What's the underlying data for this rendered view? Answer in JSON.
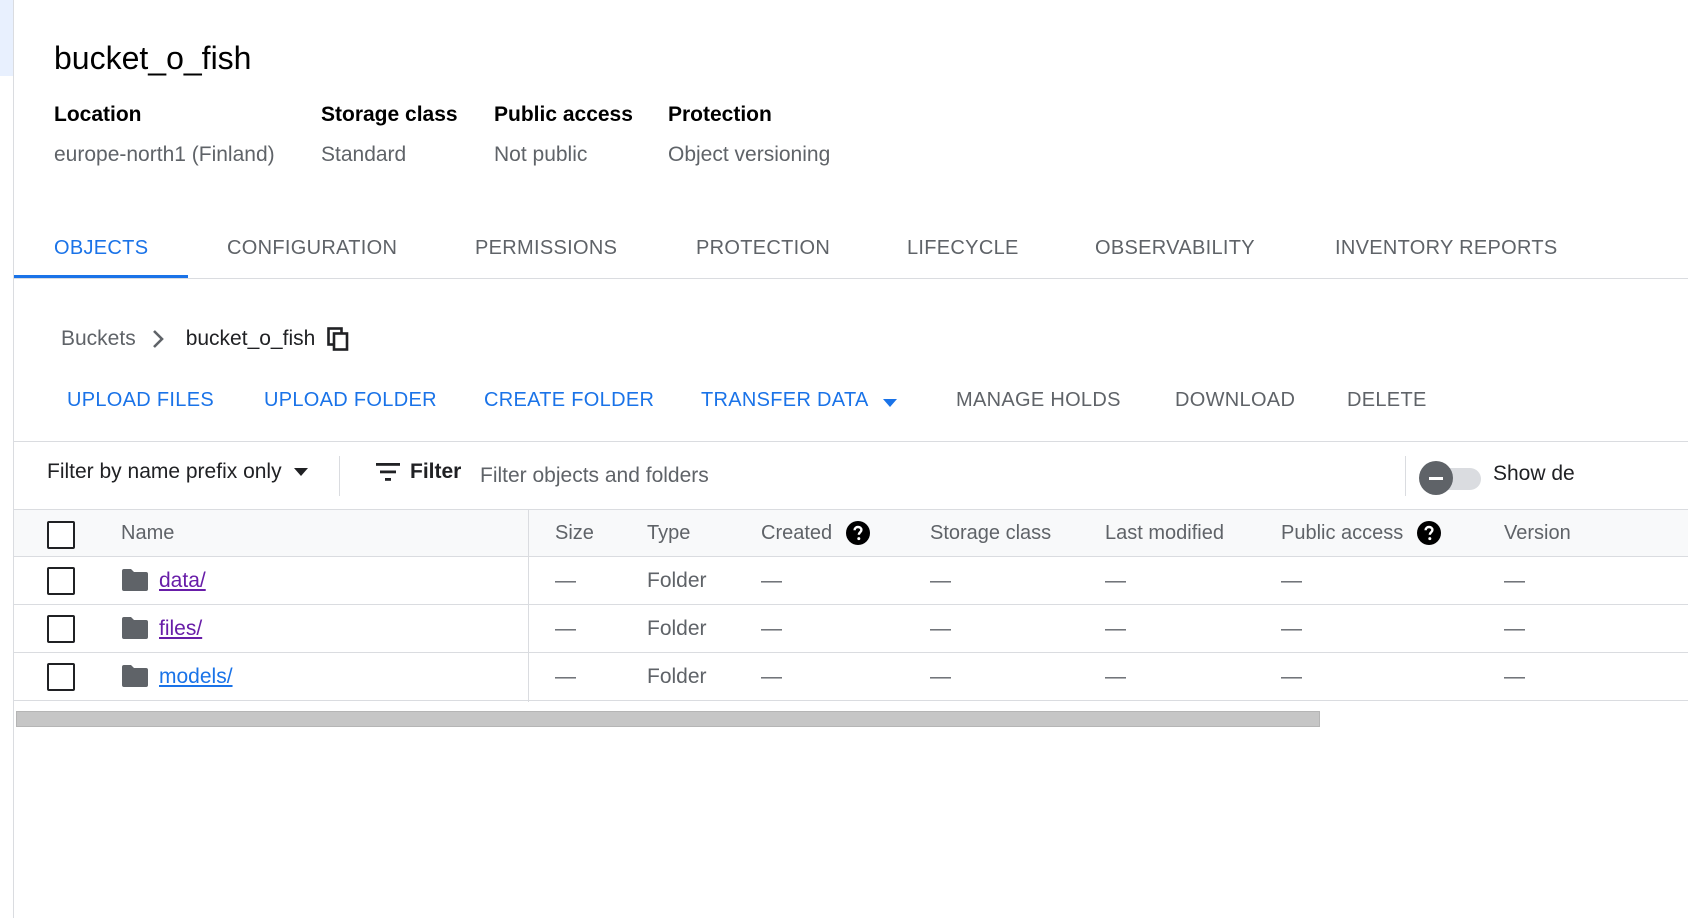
{
  "bucket": {
    "name": "bucket_o_fish",
    "details": [
      {
        "label": "Location",
        "value": "europe-north1 (Finland)"
      },
      {
        "label": "Storage class",
        "value": "Standard"
      },
      {
        "label": "Public access",
        "value": "Not public"
      },
      {
        "label": "Protection",
        "value": "Object versioning"
      }
    ]
  },
  "tabs": [
    {
      "label": "OBJECTS",
      "active": true
    },
    {
      "label": "CONFIGURATION"
    },
    {
      "label": "PERMISSIONS"
    },
    {
      "label": "PROTECTION"
    },
    {
      "label": "LIFECYCLE"
    },
    {
      "label": "OBSERVABILITY"
    },
    {
      "label": "INVENTORY REPORTS"
    }
  ],
  "breadcrumb": {
    "root": "Buckets",
    "current": "bucket_o_fish"
  },
  "actions": {
    "upload_files": "UPLOAD FILES",
    "upload_folder": "UPLOAD FOLDER",
    "create_folder": "CREATE FOLDER",
    "transfer_data": "TRANSFER DATA",
    "manage_holds": "MANAGE HOLDS",
    "download": "DOWNLOAD",
    "delete": "DELETE"
  },
  "filter": {
    "mode": "Filter by name prefix only",
    "button": "Filter",
    "placeholder": "Filter objects and folders",
    "toggle_label": "Show de"
  },
  "table": {
    "columns": [
      "Name",
      "Size",
      "Type",
      "Created",
      "Storage class",
      "Last modified",
      "Public access",
      "Version"
    ],
    "rows": [
      {
        "name": "data/",
        "size": "—",
        "type": "Folder",
        "created": "—",
        "storage_class": "—",
        "last_modified": "—",
        "public_access": "—",
        "version": "—"
      },
      {
        "name": "files/",
        "size": "—",
        "type": "Folder",
        "created": "—",
        "storage_class": "—",
        "last_modified": "—",
        "public_access": "—",
        "version": "—"
      },
      {
        "name": "models/",
        "size": "—",
        "type": "Folder",
        "created": "—",
        "storage_class": "—",
        "last_modified": "—",
        "public_access": "—",
        "version": "—"
      }
    ]
  },
  "colors": {
    "accent": "#1a73e8",
    "visited_link": "#681da8",
    "muted_text": "#5f6368"
  },
  "icons": [
    "chevron-right-icon",
    "copy-icon",
    "caret-down-icon",
    "filter-icon",
    "help-icon",
    "folder-icon"
  ]
}
